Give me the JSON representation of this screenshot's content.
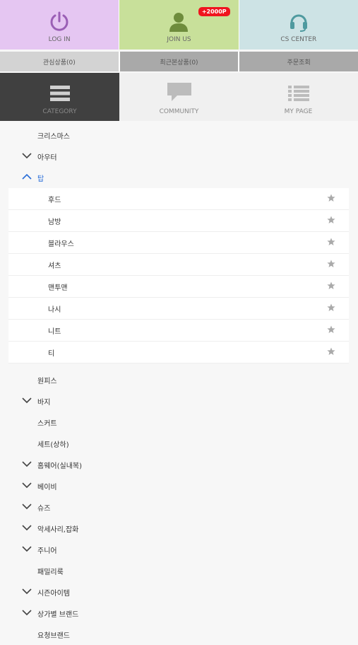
{
  "top_buttons": [
    {
      "label": "LOG IN",
      "icon": "power-icon",
      "bg": "#e5c6f2"
    },
    {
      "label": "JOIN US",
      "icon": "user-icon",
      "bg": "#c8e09a",
      "badge": "+2000P"
    },
    {
      "label": "CS CENTER",
      "icon": "headset-icon",
      "bg": "#cde3e5"
    }
  ],
  "sub_buttons": [
    {
      "label": "관심상품(0)",
      "bg": "#d3d3d3"
    },
    {
      "label": "최근본상품(0)",
      "bg": "#a9a9a9"
    },
    {
      "label": "주문조회",
      "bg": "#a9a9a9"
    }
  ],
  "tabs": [
    {
      "label": "CATEGORY",
      "icon": "menu-icon",
      "active": true
    },
    {
      "label": "COMMUNITY",
      "icon": "chat-icon",
      "active": false
    },
    {
      "label": "MY PAGE",
      "icon": "list-icon",
      "active": false
    }
  ],
  "colors": {
    "active_tab_bg": "#404040",
    "inactive_tab_bg": "#f0f0f0",
    "accent_blue": "#2a6ed8",
    "badge_red": "#f0141e"
  },
  "categories": [
    {
      "label": "크리스마스",
      "state": "none"
    },
    {
      "label": "아우터",
      "state": "collapsed"
    },
    {
      "label": "탑",
      "state": "expanded",
      "children": [
        "후드",
        "남방",
        "블라우스",
        "셔츠",
        "맨투맨",
        "나시",
        "니트",
        "티"
      ]
    },
    {
      "label": "원피스",
      "state": "none"
    },
    {
      "label": "바지",
      "state": "collapsed"
    },
    {
      "label": "스커트",
      "state": "none"
    },
    {
      "label": "세트(상하)",
      "state": "none"
    },
    {
      "label": "홈웨어(실내복)",
      "state": "collapsed"
    },
    {
      "label": "베이비",
      "state": "collapsed"
    },
    {
      "label": "슈즈",
      "state": "collapsed"
    },
    {
      "label": "악세사리,잡화",
      "state": "collapsed"
    },
    {
      "label": "주니어",
      "state": "collapsed"
    },
    {
      "label": "패밀리룩",
      "state": "none"
    },
    {
      "label": "시즌아이템",
      "state": "collapsed"
    },
    {
      "label": "상가별 브랜드",
      "state": "collapsed"
    },
    {
      "label": "요청브랜드",
      "state": "none"
    }
  ]
}
